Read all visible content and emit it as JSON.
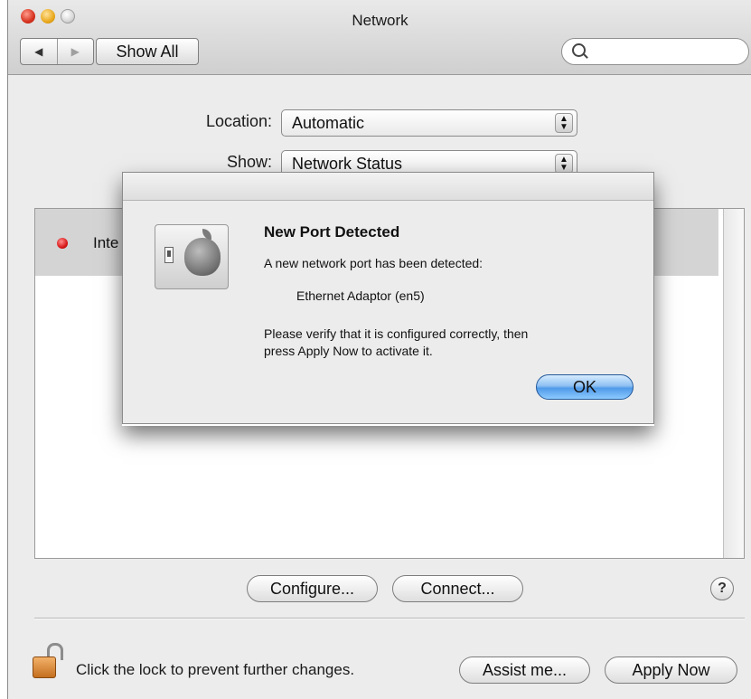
{
  "window": {
    "title": "Network"
  },
  "toolbar": {
    "back_glyph": "◀",
    "forward_glyph": "▶",
    "show_all_label": "Show All",
    "search_value": "",
    "search_placeholder": ""
  },
  "location": {
    "label": "Location:",
    "value": "Automatic"
  },
  "show": {
    "label": "Show:",
    "value": "Network Status"
  },
  "list": {
    "rows": [
      {
        "text": "Inte",
        "status": "red"
      }
    ]
  },
  "buttons": {
    "configure": "Configure...",
    "connect": "Connect...",
    "help": "?",
    "assist": "Assist me...",
    "apply": "Apply Now"
  },
  "lock_message": "Click the lock to prevent further changes.",
  "dialog": {
    "title": "New Port Detected",
    "message": "A new network port has been detected:",
    "port": "Ethernet Adaptor (en5)",
    "instructions_line1": "Please verify that it is configured correctly, then",
    "instructions_line2": "press Apply Now to activate it.",
    "ok_label": "OK"
  },
  "icons": [
    "close-icon",
    "minimize-icon",
    "zoom-icon",
    "search-icon",
    "lock-icon",
    "apple-icon",
    "switch-icon"
  ],
  "colors": {
    "ok_button": "#4f9ae9",
    "status_red": "#d91818",
    "lock": "#e08a33"
  }
}
